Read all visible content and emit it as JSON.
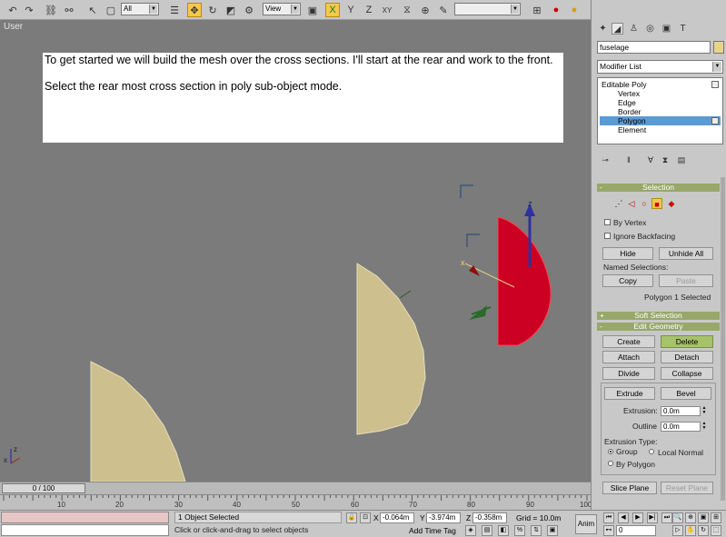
{
  "toolbar": {
    "filter_value": "All",
    "refcoord_value": "View",
    "axis_x": "X",
    "axis_y": "Y",
    "axis_z": "Z",
    "axis_xy": "XY",
    "named_selection_value": ""
  },
  "viewport": {
    "label": "User",
    "note_line1": "To get started we will build the mesh over the cross sections.  I'll start at the rear and work to the front.",
    "note_line2": "Select the rear most cross section in poly sub-object mode.",
    "gizmo_z": "z",
    "gizmo_x": "x",
    "triad_z": "z",
    "triad_x": "x"
  },
  "timeline": {
    "slider_text": "0 / 100",
    "ticks": [
      "10",
      "20",
      "30",
      "40",
      "50",
      "60",
      "70",
      "80",
      "90",
      "100"
    ]
  },
  "status": {
    "selection_text": "1 Object Selected",
    "prompt_text": "Click or click-and-drag to select objects",
    "x_label": "X",
    "x_value": "-0.064m",
    "y_label": "Y",
    "y_value": "-3.974m",
    "z_label": "Z",
    "z_value": "-0.358m",
    "grid_text": "Grid = 10.0m",
    "add_time_tag": "Add Time Tag",
    "anim_label": "Anim",
    "frame_value": "0"
  },
  "command_panel": {
    "object_name": "fuselage",
    "object_color": "#e8d48a",
    "modifier_list": "Modifier List",
    "stack": [
      {
        "label": "Editable Poly",
        "indent": 0,
        "selected": false
      },
      {
        "label": "Vertex",
        "indent": 1,
        "selected": false
      },
      {
        "label": "Edge",
        "indent": 1,
        "selected": false
      },
      {
        "label": "Border",
        "indent": 1,
        "selected": false
      },
      {
        "label": "Polygon",
        "indent": 1,
        "selected": true
      },
      {
        "label": "Element",
        "indent": 1,
        "selected": false
      }
    ],
    "selection": {
      "title": "Selection",
      "by_vertex": "By Vertex",
      "ignore_backfacing": "Ignore Backfacing",
      "hide": "Hide",
      "unhide_all": "Unhide All",
      "named_selections": "Named Selections:",
      "copy": "Copy",
      "paste": "Paste",
      "status": "Polygon 1 Selected"
    },
    "soft_selection": {
      "sign": "+",
      "title": "Soft Selection"
    },
    "edit_geometry": {
      "sign": "-",
      "title": "Edit Geometry",
      "create": "Create",
      "delete": "Delete",
      "attach": "Attach",
      "detach": "Detach",
      "divide": "Divide",
      "collapse": "Collapse",
      "extrude": "Extrude",
      "bevel": "Bevel",
      "extrusion_label": "Extrusion:",
      "extrusion_value": "0.0m",
      "outline_label": "Outline",
      "outline_value": "0.0m",
      "extrusion_type": "Extrusion Type:",
      "group": "Group",
      "local_normal": "Local Normal",
      "by_polygon": "By Polygon",
      "slice_plane": "Slice Plane",
      "reset_plane": "Reset Plane"
    },
    "selection_sign": "-"
  },
  "colors": {
    "viewport_bg": "#7b7b7b",
    "section_fill": "#cdbf8e",
    "selected_fill": "#cc0022",
    "rollout_head": "#98a86a",
    "active_tool": "#f2c94c"
  }
}
